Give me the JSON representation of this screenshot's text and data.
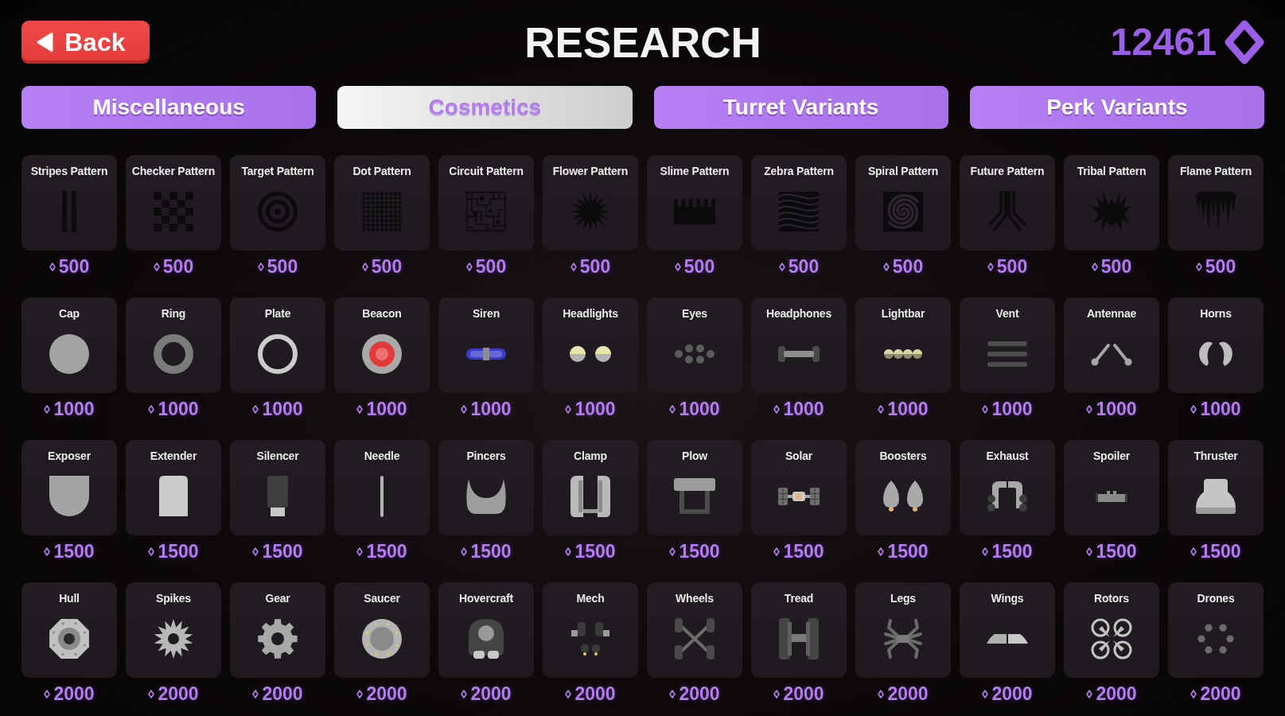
{
  "header": {
    "back_label": "Back",
    "title": "RESEARCH",
    "currency": "12461"
  },
  "tabs": [
    {
      "label": "Miscellaneous",
      "selected": false
    },
    {
      "label": "Cosmetics",
      "selected": true
    },
    {
      "label": "Turret Variants",
      "selected": false
    },
    {
      "label": "Perk Variants",
      "selected": false
    }
  ],
  "items": [
    {
      "name": "Stripes Pattern",
      "price": "500"
    },
    {
      "name": "Checker Pattern",
      "price": "500"
    },
    {
      "name": "Target Pattern",
      "price": "500"
    },
    {
      "name": "Dot Pattern",
      "price": "500"
    },
    {
      "name": "Circuit Pattern",
      "price": "500"
    },
    {
      "name": "Flower Pattern",
      "price": "500"
    },
    {
      "name": "Slime Pattern",
      "price": "500"
    },
    {
      "name": "Zebra Pattern",
      "price": "500"
    },
    {
      "name": "Spiral Pattern",
      "price": "500"
    },
    {
      "name": "Future Pattern",
      "price": "500"
    },
    {
      "name": "Tribal Pattern",
      "price": "500"
    },
    {
      "name": "Flame Pattern",
      "price": "500"
    },
    {
      "name": "Cap",
      "price": "1000"
    },
    {
      "name": "Ring",
      "price": "1000"
    },
    {
      "name": "Plate",
      "price": "1000"
    },
    {
      "name": "Beacon",
      "price": "1000"
    },
    {
      "name": "Siren",
      "price": "1000"
    },
    {
      "name": "Headlights",
      "price": "1000"
    },
    {
      "name": "Eyes",
      "price": "1000"
    },
    {
      "name": "Headphones",
      "price": "1000"
    },
    {
      "name": "Lightbar",
      "price": "1000"
    },
    {
      "name": "Vent",
      "price": "1000"
    },
    {
      "name": "Antennae",
      "price": "1000"
    },
    {
      "name": "Horns",
      "price": "1000"
    },
    {
      "name": "Exposer",
      "price": "1500"
    },
    {
      "name": "Extender",
      "price": "1500"
    },
    {
      "name": "Silencer",
      "price": "1500"
    },
    {
      "name": "Needle",
      "price": "1500"
    },
    {
      "name": "Pincers",
      "price": "1500"
    },
    {
      "name": "Clamp",
      "price": "1500"
    },
    {
      "name": "Plow",
      "price": "1500"
    },
    {
      "name": "Solar",
      "price": "1500"
    },
    {
      "name": "Boosters",
      "price": "1500"
    },
    {
      "name": "Exhaust",
      "price": "1500"
    },
    {
      "name": "Spoiler",
      "price": "1500"
    },
    {
      "name": "Thruster",
      "price": "1500"
    },
    {
      "name": "Hull",
      "price": "2000"
    },
    {
      "name": "Spikes",
      "price": "2000"
    },
    {
      "name": "Gear",
      "price": "2000"
    },
    {
      "name": "Saucer",
      "price": "2000"
    },
    {
      "name": "Hovercraft",
      "price": "2000"
    },
    {
      "name": "Mech",
      "price": "2000"
    },
    {
      "name": "Wheels",
      "price": "2000"
    },
    {
      "name": "Tread",
      "price": "2000"
    },
    {
      "name": "Legs",
      "price": "2000"
    },
    {
      "name": "Wings",
      "price": "2000"
    },
    {
      "name": "Rotors",
      "price": "2000"
    },
    {
      "name": "Drones",
      "price": "2000"
    }
  ]
}
